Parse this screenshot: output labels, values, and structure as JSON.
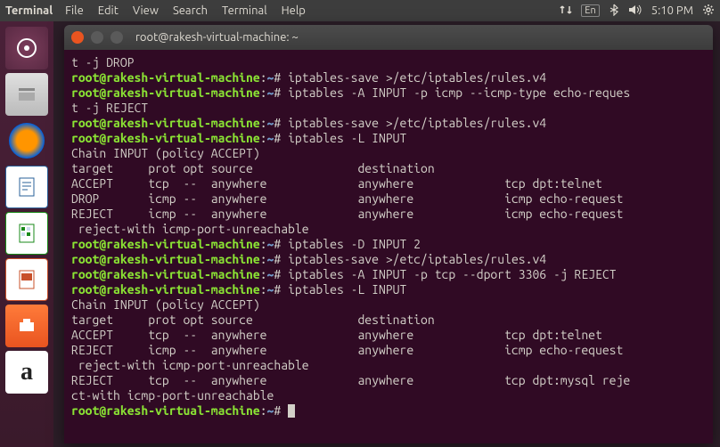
{
  "panel": {
    "app": "Terminal",
    "menu": [
      "Terminal",
      "File",
      "Edit",
      "View",
      "Search",
      "Terminal",
      "Help"
    ],
    "lang": "En",
    "time": "5:10 PM"
  },
  "launcher": {
    "items": [
      {
        "name": "dash",
        "active": false
      },
      {
        "name": "files",
        "active": false
      },
      {
        "name": "firefox",
        "active": false
      },
      {
        "name": "writer",
        "active": false
      },
      {
        "name": "calc",
        "active": false
      },
      {
        "name": "impress",
        "active": false
      },
      {
        "name": "software",
        "active": false
      },
      {
        "name": "amazon",
        "active": false
      }
    ]
  },
  "window": {
    "title": "root@rakesh-virtual-machine: ~"
  },
  "prompt": {
    "user_host": "root@rakesh-virtual-machine",
    "path": "~",
    "sep": ":",
    "suffix": "#"
  },
  "lines": [
    {
      "t": "out",
      "text": "t -j DROP"
    },
    {
      "t": "cmd",
      "text": "iptables-save >/etc/iptables/rules.v4"
    },
    {
      "t": "cmd",
      "text": "iptables -A INPUT -p icmp --icmp-type echo-reques"
    },
    {
      "t": "out",
      "text": "t -j REJECT"
    },
    {
      "t": "cmd",
      "text": "iptables-save >/etc/iptables/rules.v4"
    },
    {
      "t": "cmd",
      "text": "iptables -L INPUT"
    },
    {
      "t": "out",
      "text": "Chain INPUT (policy ACCEPT)"
    },
    {
      "t": "out",
      "text": "target     prot opt source               destination"
    },
    {
      "t": "out",
      "text": "ACCEPT     tcp  --  anywhere             anywhere             tcp dpt:telnet"
    },
    {
      "t": "out",
      "text": "DROP       icmp --  anywhere             anywhere             icmp echo-request"
    },
    {
      "t": "out",
      "text": "REJECT     icmp --  anywhere             anywhere             icmp echo-request"
    },
    {
      "t": "out",
      "text": " reject-with icmp-port-unreachable"
    },
    {
      "t": "cmd",
      "text": "iptables -D INPUT 2"
    },
    {
      "t": "cmd",
      "text": "iptables-save >/etc/iptables/rules.v4"
    },
    {
      "t": "cmd",
      "text": "iptables -A INPUT -p tcp --dport 3306 -j REJECT"
    },
    {
      "t": "cmd",
      "text": "iptables -L INPUT"
    },
    {
      "t": "out",
      "text": "Chain INPUT (policy ACCEPT)"
    },
    {
      "t": "out",
      "text": "target     prot opt source               destination"
    },
    {
      "t": "out",
      "text": "ACCEPT     tcp  --  anywhere             anywhere             tcp dpt:telnet"
    },
    {
      "t": "out",
      "text": "REJECT     icmp --  anywhere             anywhere             icmp echo-request"
    },
    {
      "t": "out",
      "text": " reject-with icmp-port-unreachable"
    },
    {
      "t": "out",
      "text": "REJECT     tcp  --  anywhere             anywhere             tcp dpt:mysql reje"
    },
    {
      "t": "out",
      "text": "ct-with icmp-port-unreachable"
    },
    {
      "t": "cmd",
      "text": ""
    }
  ]
}
